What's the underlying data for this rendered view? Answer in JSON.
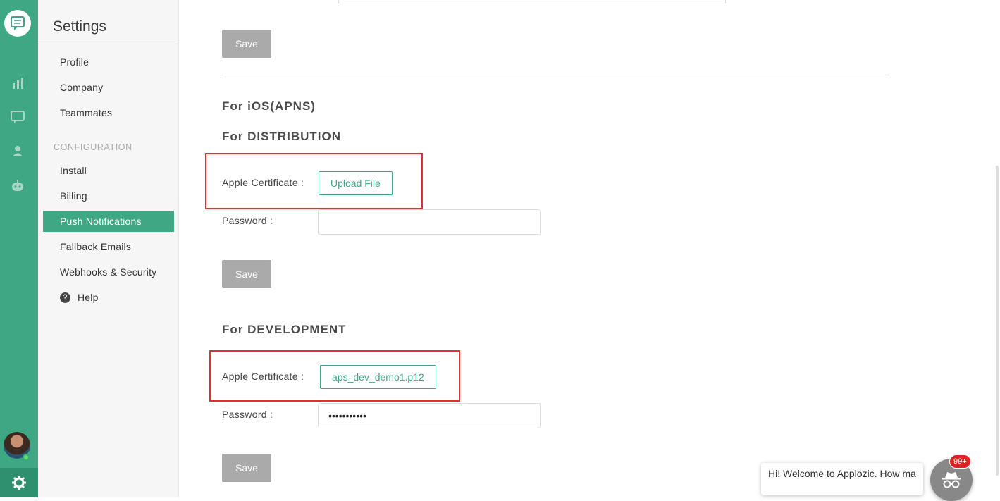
{
  "sidebar": {
    "title": "Settings",
    "items_top": [
      {
        "label": "Profile"
      },
      {
        "label": "Company"
      },
      {
        "label": "Teammates"
      }
    ],
    "section_label": "CONFIGURATION",
    "items_config": [
      {
        "label": "Install"
      },
      {
        "label": "Billing"
      },
      {
        "label": "Push Notifications",
        "active": true
      },
      {
        "label": "Fallback Emails"
      },
      {
        "label": "Webhooks & Security"
      }
    ],
    "help_label": "Help"
  },
  "main": {
    "save_label": "Save",
    "ios_heading": "For iOS(APNS)",
    "distribution": {
      "heading": "For DISTRIBUTION",
      "cert_label": "Apple Certificate :",
      "cert_button": "Upload File",
      "password_label": "Password :",
      "password_value": ""
    },
    "development": {
      "heading": "For DEVELOPMENT",
      "cert_label": "Apple Certificate :",
      "cert_button": "aps_dev_demo1.p12",
      "password_label": "Password :",
      "password_value": "•••••••••••"
    }
  },
  "chat": {
    "message": "Hi! Welcome to Applozic. How ma",
    "badge": "99+"
  },
  "colors": {
    "accent": "#3ea884",
    "highlight": "#e03030",
    "save_button": "#aaaaaa"
  },
  "icons": {
    "rail": [
      "chat-logo-icon",
      "bar-chart-icon",
      "conversation-icon",
      "user-icon",
      "bot-icon",
      "gear-icon"
    ],
    "help": "question-circle-icon",
    "chat_launcher": "incognito-icon"
  }
}
